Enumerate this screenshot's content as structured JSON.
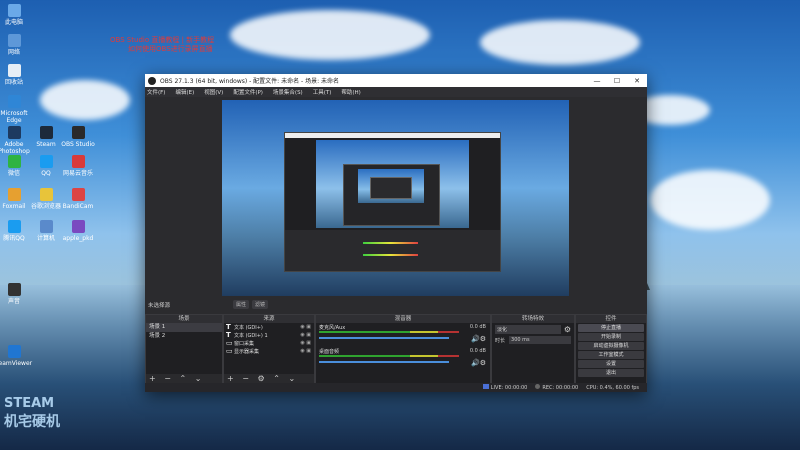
{
  "desktop": {
    "icons": [
      {
        "label": "此电脑",
        "icon": "computer-icon",
        "color": "#6aa9e8"
      },
      {
        "label": "网络",
        "icon": "network-icon",
        "color": "#5e98d8"
      },
      {
        "label": "回收站",
        "icon": "recycle-bin-icon",
        "color": "#e6eef6"
      },
      {
        "label": "Microsoft Edge",
        "icon": "edge-icon",
        "color": "#2f86d6"
      },
      {
        "label": "Adobe Photoshop",
        "icon": "photoshop-icon",
        "color": "#1d3a60"
      },
      {
        "label": "Steam",
        "icon": "steam-icon",
        "color": "#1d2a3a"
      },
      {
        "label": "OBS Studio",
        "icon": "obs-icon",
        "color": "#2a2a2a"
      },
      {
        "label": "微信",
        "icon": "wechat-icon",
        "color": "#2fb342"
      },
      {
        "label": "QQ",
        "icon": "qq-icon",
        "color": "#1a9cf0"
      },
      {
        "label": "网易云音乐",
        "icon": "music-icon",
        "color": "#d83a3a"
      },
      {
        "label": "Foxmail",
        "icon": "mail-icon",
        "color": "#e6a030"
      },
      {
        "label": "谷歌浏览器",
        "icon": "chrome-icon",
        "color": "#e8c43a"
      },
      {
        "label": "BandiCam",
        "icon": "camera-icon",
        "color": "#d44"
      },
      {
        "label": "腾讯QQ",
        "icon": "qq-icon",
        "color": "#1a9cf0"
      },
      {
        "label": "计算机",
        "icon": "computer-icon",
        "color": "#5a8acb"
      },
      {
        "label": "apple_pkd",
        "icon": "app-icon",
        "color": "#7a4ac0"
      },
      {
        "label": "声音",
        "icon": "audio-icon",
        "color": "#333"
      },
      {
        "label": "TeamViewer",
        "icon": "teamviewer-icon",
        "color": "#2076d2"
      }
    ],
    "red_note_line1": "OBS Studio 直播教程 | 新手教程",
    "red_note_line2": "如何使用OBS进行录屏直播",
    "watermark_line1": "STEAM",
    "watermark_line2": "机宅硬机"
  },
  "obs": {
    "title": "OBS 27.1.3 (64 bit, windows) - 配置文件: 未命名 - 场景: 未命名",
    "menu": [
      "文件(F)",
      "编辑(E)",
      "视图(V)",
      "配置文件(P)",
      "场景集合(S)",
      "工具(T)",
      "帮助(H)"
    ],
    "preview_label": "未选择源",
    "pills": [
      "属性",
      "滤镜"
    ],
    "docks": {
      "scenes": {
        "title": "场景",
        "items": [
          "场景 1",
          "场景 2"
        ],
        "footer": "+ − ⌃ ⌄"
      },
      "sources": {
        "title": "来源",
        "items": [
          {
            "icon": "T",
            "name": "文本 (GDI+)"
          },
          {
            "icon": "T",
            "name": "文本 (GDI+) 1"
          },
          {
            "icon": "▭",
            "name": "窗口采集"
          },
          {
            "icon": "▭",
            "name": "显示器采集"
          }
        ],
        "footer": "+ − ⚙ ⌃ ⌄"
      },
      "mixer": {
        "title": "混音器",
        "tracks": [
          {
            "name": "麦克风/Aux",
            "db": "0.0 dB"
          },
          {
            "name": "桌面音频",
            "db": "0.0 dB"
          }
        ]
      },
      "transitions": {
        "title": "转场特效",
        "type": "淡化",
        "duration_label": "时长",
        "duration": "300 ms"
      },
      "controls": {
        "title": "控件",
        "buttons": [
          "停止直播",
          "开始录制",
          "启动虚拟摄像机",
          "工作室模式",
          "设置",
          "退出"
        ]
      }
    },
    "status": {
      "live_label": "LIVE:",
      "live_time": "00:00:00",
      "rec_label": "REC:",
      "rec_time": "00:00:00",
      "cpu": "CPU: 0.4%, 60.00 fps"
    }
  }
}
